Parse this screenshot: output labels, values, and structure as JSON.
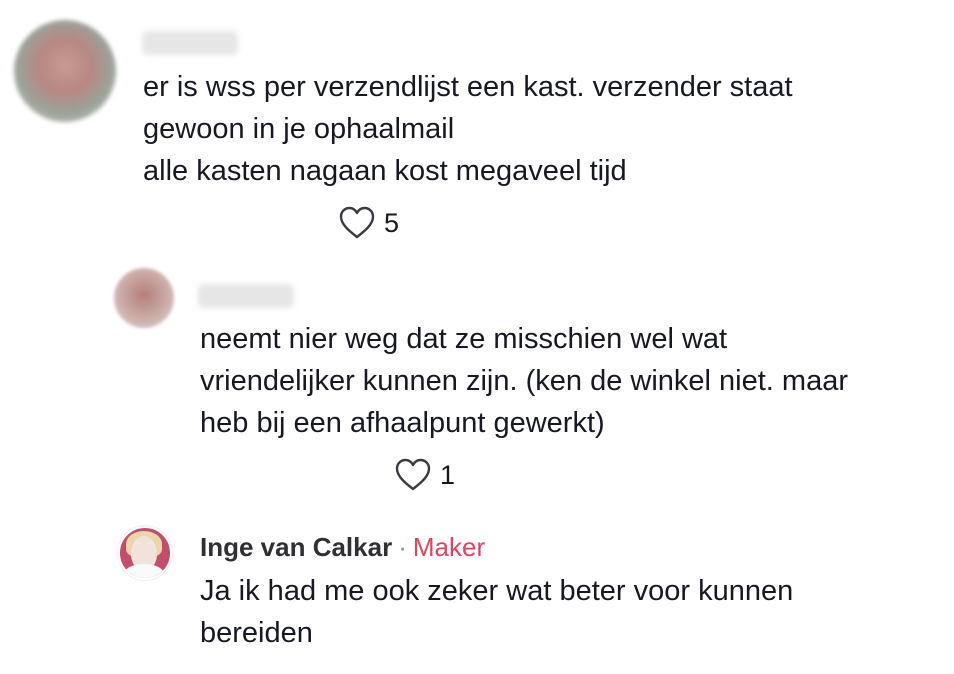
{
  "comments": [
    {
      "text": "er is wss per verzendlijst een kast. verzender staat\ngewoon in je ophaalmail\nalle kasten nagaan kost megaveel tijd",
      "likes": "5"
    },
    {
      "text": "neemt nier weg dat ze misschien wel wat\nvriendelijker kunnen zijn. (ken de winkel niet. maar\nheb bij een afhaalpunt gewerkt)",
      "likes": "1"
    },
    {
      "author": "Inge van Calkar",
      "separator": "·",
      "badge": "Maker",
      "text": "Ja ik had me ook zeker wat beter voor kunnen\nbereiden"
    }
  ],
  "colors": {
    "text": "#161823",
    "creator_badge": "#e2445f",
    "separator": "#8a8b91"
  },
  "icons": {
    "like": "heart-outline-icon"
  }
}
